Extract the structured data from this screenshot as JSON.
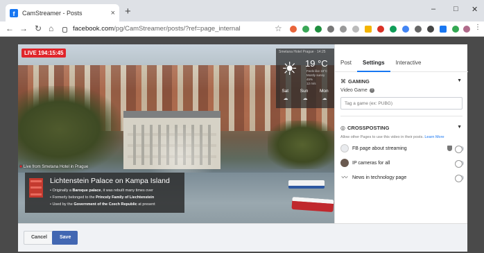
{
  "browser": {
    "tab_title": "CamStreamer - Posts",
    "tab_close": "×",
    "new_tab": "+",
    "url_domain": "facebook.com",
    "url_path": "/pg/CamStreamer/posts/?ref=page_internal",
    "window_minimize": "–",
    "window_maximize": "□",
    "window_close": "✕"
  },
  "video": {
    "live_label": "LIVE 194:15:45",
    "weather": {
      "header": "Smetana Hotel Prague · 14:25",
      "temperature": "19 °C",
      "details": [
        "Feels like 18°C",
        "Mostly sunny",
        "45%",
        "12 m/s"
      ],
      "days": [
        "Sat",
        "Sun",
        "Mon"
      ]
    },
    "caption": "Live from Smetana Hotel in Prague",
    "info": {
      "title": "Lichtenstein Palace on Kampa Island",
      "line1_pre": "• Originally a ",
      "line1_bold": "Baroque palace",
      "line1_post": ", it was rebuilt many times over",
      "line2_pre": "• Formerly belonged to the ",
      "line2_bold": "Princely Family of Liechtenstein",
      "line3_pre": "• Used by the ",
      "line3_bold": "Government of the Czech Republic",
      "line3_post": " at present"
    }
  },
  "panel": {
    "tabs": [
      "Post",
      "Settings",
      "Interactive"
    ],
    "active_tab": "Settings",
    "gaming": {
      "title": "GAMING",
      "field_label": "Video Game",
      "placeholder": "Tag a game (ex: PUBG)"
    },
    "crossposting": {
      "title": "CROSSPOSTING",
      "description": "Allow other Pages to use this video in their posts.",
      "learn_more": "Learn More",
      "pages": [
        {
          "name": "FB page about streaming",
          "enabled": false
        },
        {
          "name": "IP cameras for all",
          "enabled": false
        },
        {
          "name": "News in technology page",
          "enabled": false
        }
      ]
    }
  },
  "footer": {
    "cancel_label": "Cancel",
    "save_label": "Save"
  },
  "colors": {
    "facebook_blue": "#1877f2",
    "save_button": "#4267b2",
    "live_red": "#e0242a"
  }
}
